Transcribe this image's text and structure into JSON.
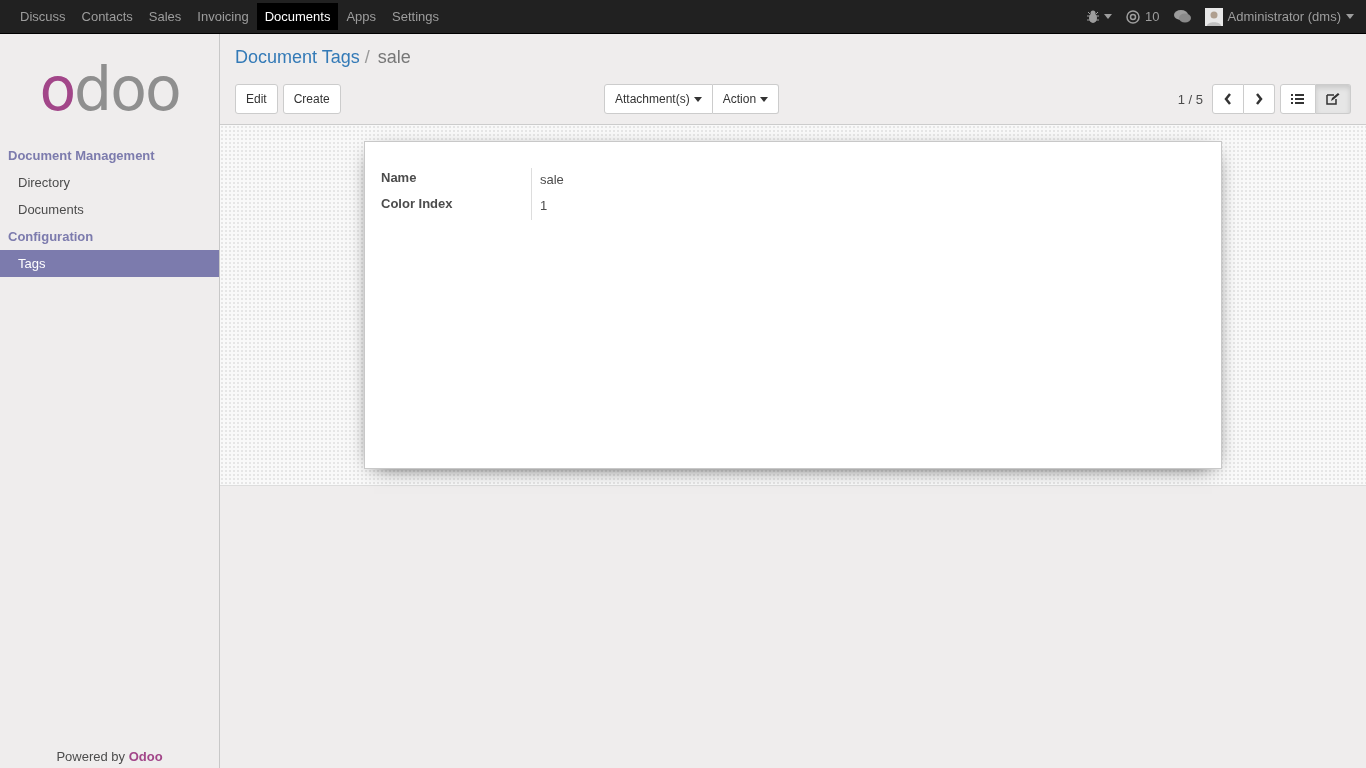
{
  "top_menu": [
    {
      "label": "Discuss",
      "selected": false
    },
    {
      "label": "Contacts",
      "selected": false
    },
    {
      "label": "Sales",
      "selected": false
    },
    {
      "label": "Invoicing",
      "selected": false
    },
    {
      "label": "Documents",
      "selected": true
    },
    {
      "label": "Apps",
      "selected": false
    },
    {
      "label": "Settings",
      "selected": false
    }
  ],
  "systray": {
    "mentions": "10",
    "user": "Administrator (dms)"
  },
  "sidebar": {
    "logo": "odoo",
    "sections": [
      {
        "title": "Document Management",
        "items": [
          {
            "label": "Directory",
            "selected": false
          },
          {
            "label": "Documents",
            "selected": false
          }
        ]
      },
      {
        "title": "Configuration",
        "items": [
          {
            "label": "Tags",
            "selected": true
          }
        ]
      }
    ],
    "footer": "Powered by **Odoo**"
  },
  "breadcrumb_separator": "/",
  "breadcrumb": [
    {
      "label": "Document Tags",
      "kind": "link"
    },
    {
      "label": "sale",
      "kind": "current"
    }
  ],
  "buttons": [
    "Edit",
    "Create"
  ],
  "dropdowns": [
    "Attachment(s)",
    "Action"
  ],
  "pager": "1 / 5",
  "views": [
    {
      "kind": "list",
      "selected": false
    },
    {
      "kind": "form",
      "selected": true
    }
  ],
  "form": {
    "fields": [
      {
        "label": "Name",
        "value": "sale"
      },
      {
        "label": "Color Index",
        "value": "1"
      }
    ]
  }
}
